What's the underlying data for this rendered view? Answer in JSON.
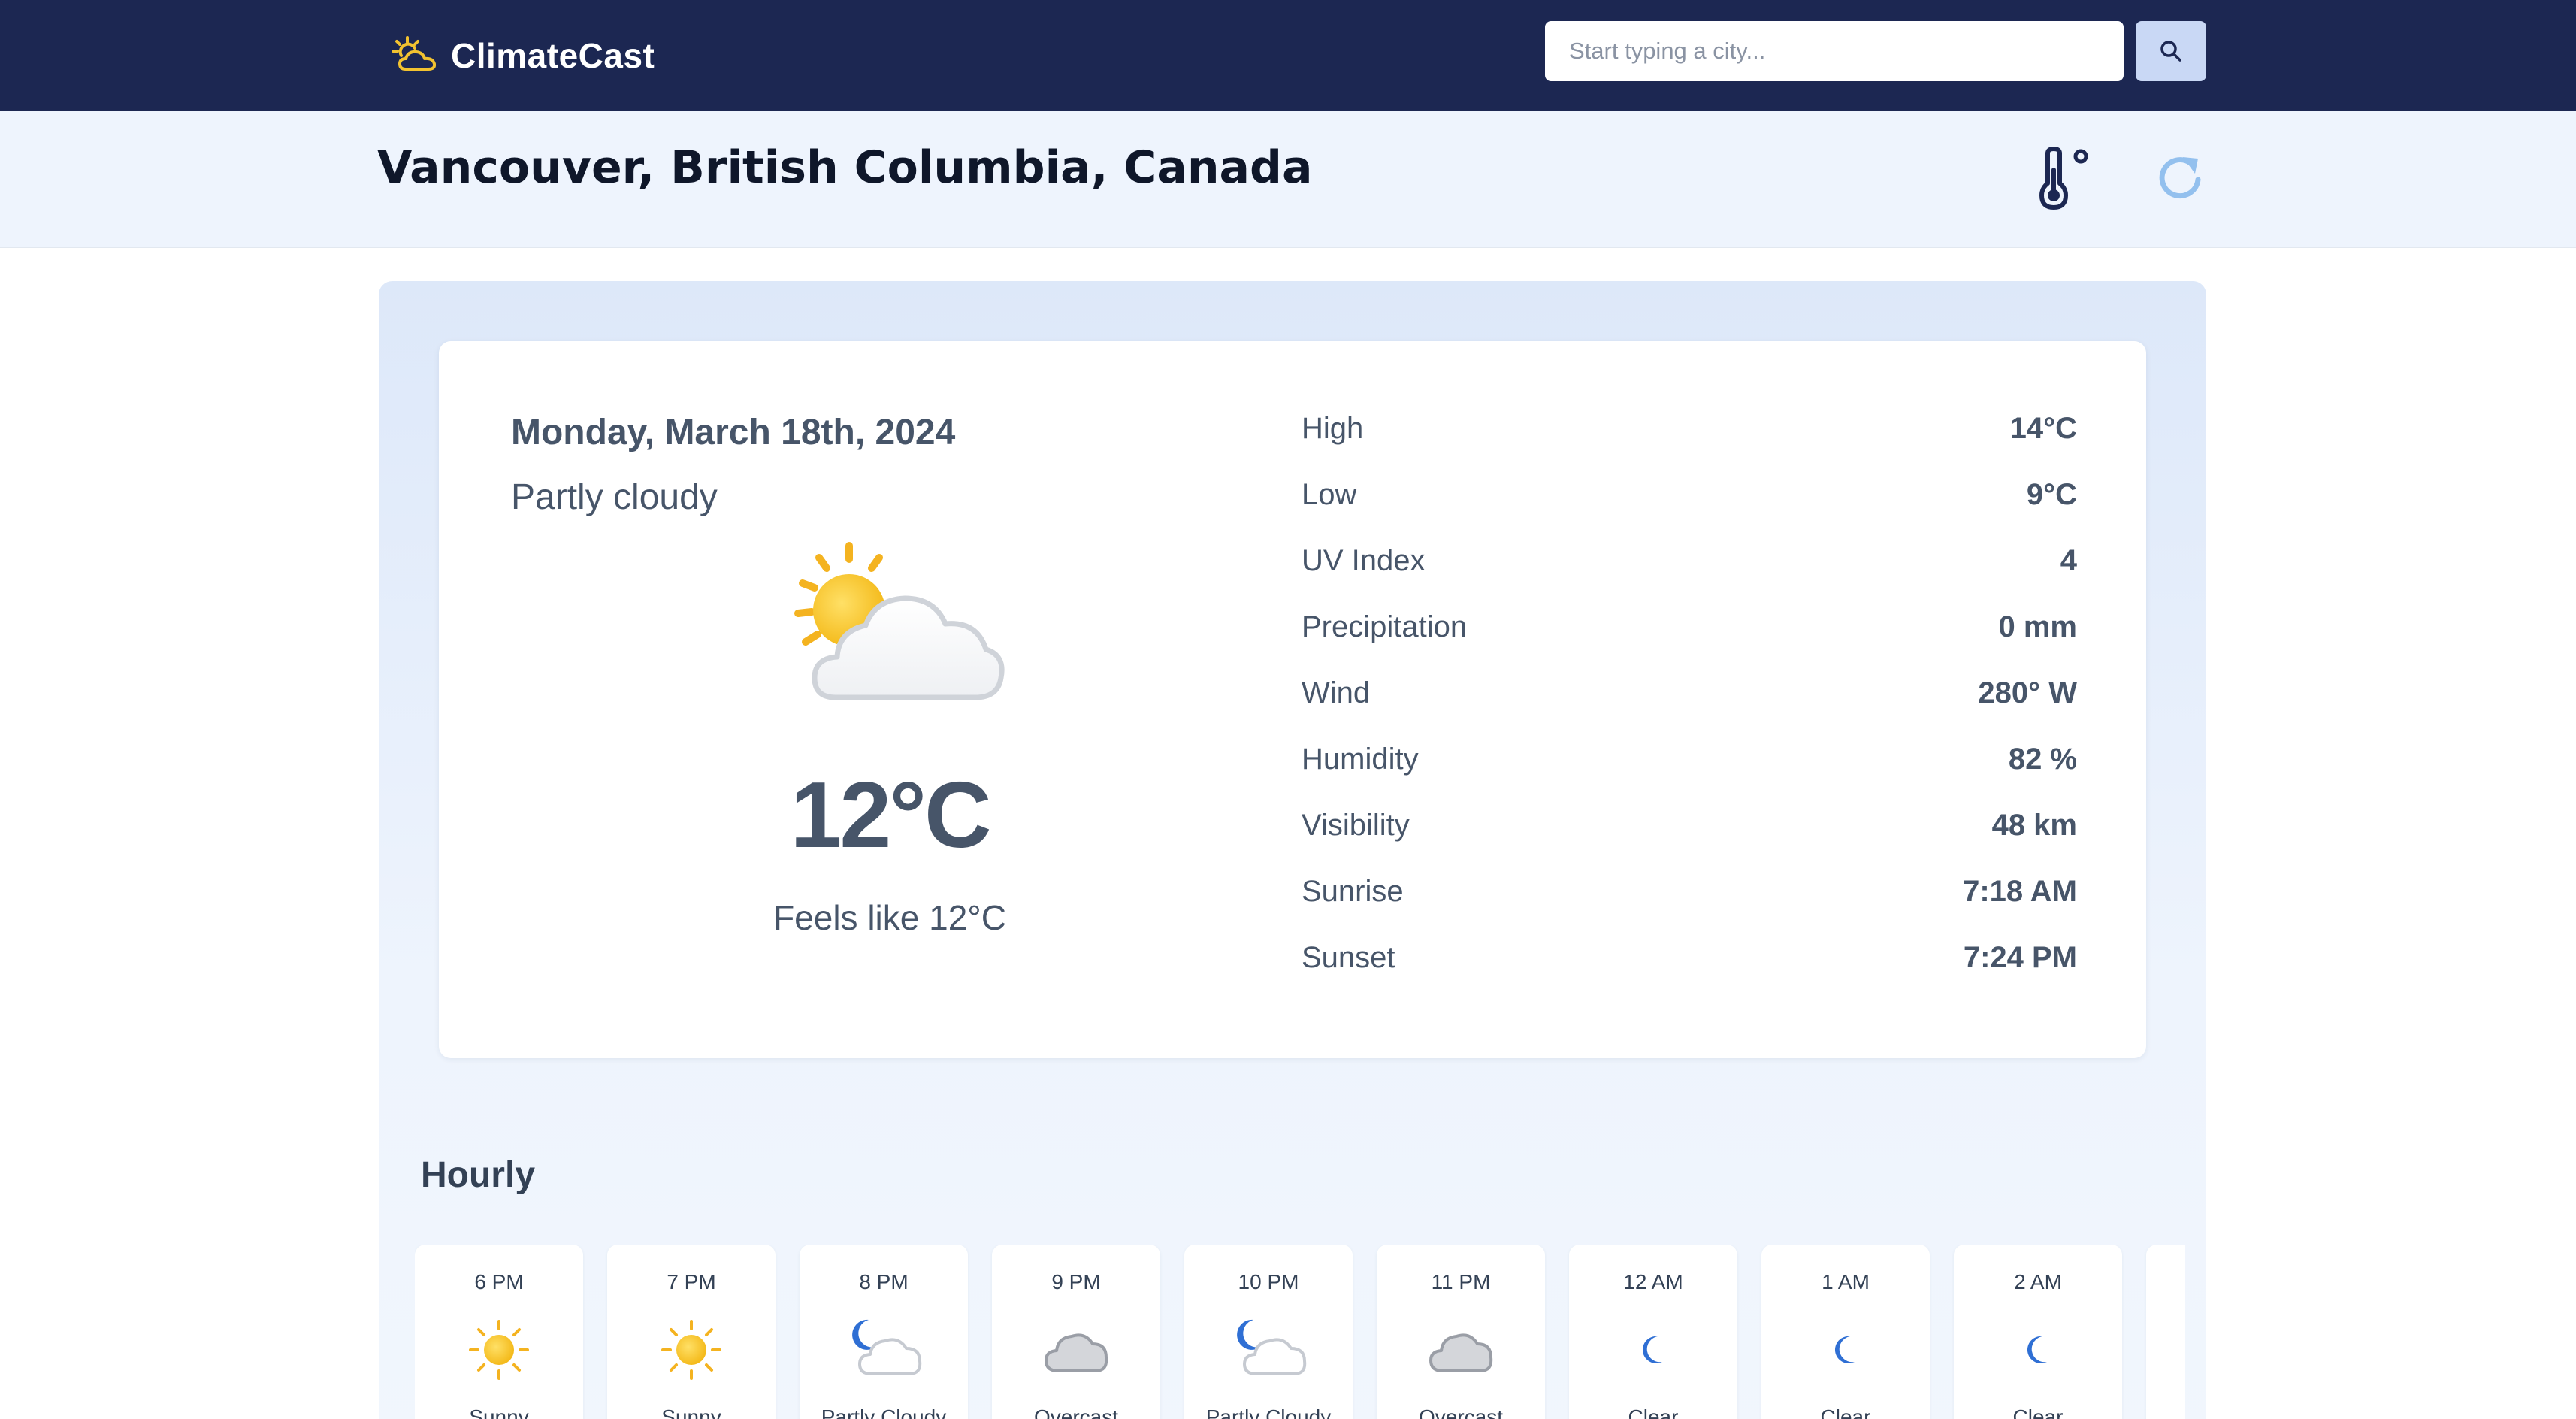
{
  "app": {
    "name": "ClimateCast",
    "logo_icon": "sun-cloud-icon"
  },
  "search": {
    "placeholder": "Start typing a city...",
    "value": "",
    "button_icon": "search-icon"
  },
  "location": {
    "title": "Vancouver, British Columbia, Canada",
    "unit_toggle_icon": "thermometer-degree-icon",
    "refresh_icon": "refresh-icon"
  },
  "current": {
    "date": "Monday, March 18th, 2024",
    "condition": "Partly cloudy",
    "icon": "partly-cloudy-icon",
    "temperature": "12°C",
    "feels_like": "Feels like 12°C"
  },
  "stats": [
    {
      "label": "High",
      "value": "14°C"
    },
    {
      "label": "Low",
      "value": "9°C"
    },
    {
      "label": "UV Index",
      "value": "4"
    },
    {
      "label": "Precipitation",
      "value": "0 mm"
    },
    {
      "label": "Wind",
      "value": "280° W"
    },
    {
      "label": "Humidity",
      "value": "82 %"
    },
    {
      "label": "Visibility",
      "value": "48 km"
    },
    {
      "label": "Sunrise",
      "value": "7:18 AM"
    },
    {
      "label": "Sunset",
      "value": "7:24 PM"
    }
  ],
  "hourly": {
    "title": "Hourly",
    "items": [
      {
        "time": "6 PM",
        "condition": "Sunny",
        "icon": "sun-icon"
      },
      {
        "time": "7 PM",
        "condition": "Sunny",
        "icon": "sun-icon"
      },
      {
        "time": "8 PM",
        "condition": "Partly Cloudy",
        "icon": "moon-cloud-icon"
      },
      {
        "time": "9 PM",
        "condition": "Overcast",
        "icon": "cloud-icon"
      },
      {
        "time": "10 PM",
        "condition": "Partly Cloudy",
        "icon": "moon-cloud-icon"
      },
      {
        "time": "11 PM",
        "condition": "Overcast",
        "icon": "cloud-icon"
      },
      {
        "time": "12 AM",
        "condition": "Clear",
        "icon": "moon-icon"
      },
      {
        "time": "1 AM",
        "condition": "Clear",
        "icon": "moon-icon"
      },
      {
        "time": "2 AM",
        "condition": "Clear",
        "icon": "moon-icon"
      }
    ]
  },
  "colors": {
    "nav_bg": "#1c2752",
    "location_bg": "#eef4fd",
    "accent": "#c9d8f5",
    "text": "#475569"
  }
}
